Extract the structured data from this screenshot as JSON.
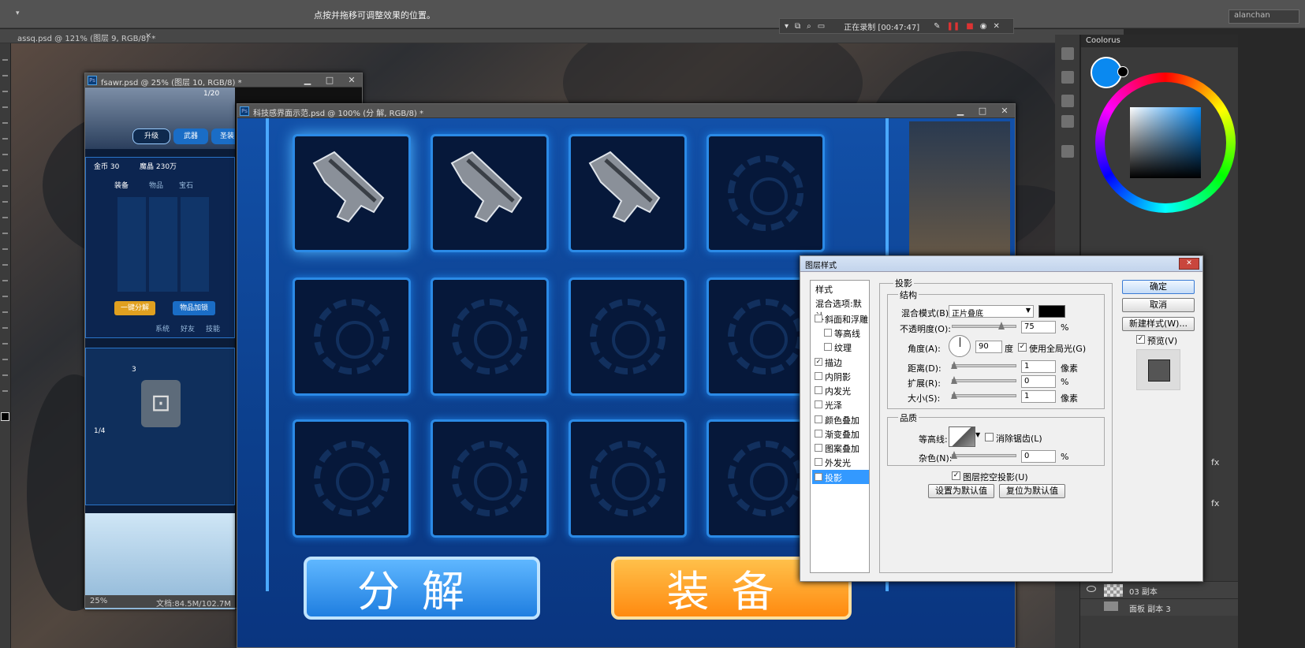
{
  "topbar": {
    "hint": "点按并拖移可调整效果的位置。",
    "user": "alanchan"
  },
  "recorder": {
    "status": "正在录制 [00:47:47]"
  },
  "documents": {
    "main_tab": "assq.psd @ 121% (图层 9, RGB/8) *",
    "doc1_title": "fsawr.psd @ 25% (图层 10, RGB/8) *",
    "doc2_title": "科技感界面示范.psd @ 100% (分 解, RGB/8) *",
    "doc1_zoom": "25%",
    "doc1_size": "文档:84.5M/102.7M"
  },
  "doc1": {
    "page": "1/20",
    "tabs": [
      "升级",
      "武器",
      "圣装"
    ],
    "currency": "金币 30",
    "gems": "魔晶 230万",
    "bag_tabs": [
      "装备",
      "物品",
      "宝石"
    ],
    "bag_btn1": "一键分解",
    "bag_btn2": "物品加锁",
    "bottom_nav": [
      "系统",
      "好友",
      "技能"
    ],
    "page2": "1/4",
    "count": "3"
  },
  "game": {
    "btn_left": "分解",
    "btn_right": "装备"
  },
  "color_panel": {
    "title": "Coolorus"
  },
  "layers": [
    {
      "name": "03 副本"
    },
    {
      "name": "面板 副本 3"
    }
  ],
  "dialog": {
    "title": "图层样式",
    "close": "✕",
    "styles_header": "样式",
    "blend_options": "混合选项:默认",
    "styles": [
      {
        "label": "斜面和浮雕",
        "checked": false
      },
      {
        "label": "等高线",
        "checked": false
      },
      {
        "label": "纹理",
        "checked": false
      },
      {
        "label": "描边",
        "checked": true
      },
      {
        "label": "内阴影",
        "checked": false
      },
      {
        "label": "内发光",
        "checked": false
      },
      {
        "label": "光泽",
        "checked": false
      },
      {
        "label": "颜色叠加",
        "checked": false
      },
      {
        "label": "渐变叠加",
        "checked": false
      },
      {
        "label": "图案叠加",
        "checked": false
      },
      {
        "label": "外发光",
        "checked": false
      },
      {
        "label": "投影",
        "checked": true
      }
    ],
    "section": "投影",
    "structure": "结构",
    "blend_mode_label": "混合模式(B):",
    "blend_mode": "正片叠底",
    "opacity_label": "不透明度(O):",
    "opacity": "75",
    "pct": "%",
    "angle_label": "角度(A):",
    "angle": "90",
    "deg": "度",
    "global_light": "使用全局光(G)",
    "distance_label": "距离(D):",
    "distance": "1",
    "spread_label": "扩展(R):",
    "spread": "0",
    "size_label": "大小(S):",
    "size": "1",
    "px": "像素",
    "quality": "品质",
    "contour_label": "等高线:",
    "anti_alias": "消除锯齿(L)",
    "noise_label": "杂色(N):",
    "noise": "0",
    "knockout": "图层挖空投影(U)",
    "set_default": "设置为默认值",
    "reset_default": "复位为默认值",
    "ok": "确定",
    "cancel": "取消",
    "new_style": "新建样式(W)...",
    "preview": "预览(V)"
  },
  "colors": {
    "accent": "#0a89f0",
    "tile_border": "#2b8ae6",
    "equip": "#ff9a1f"
  }
}
